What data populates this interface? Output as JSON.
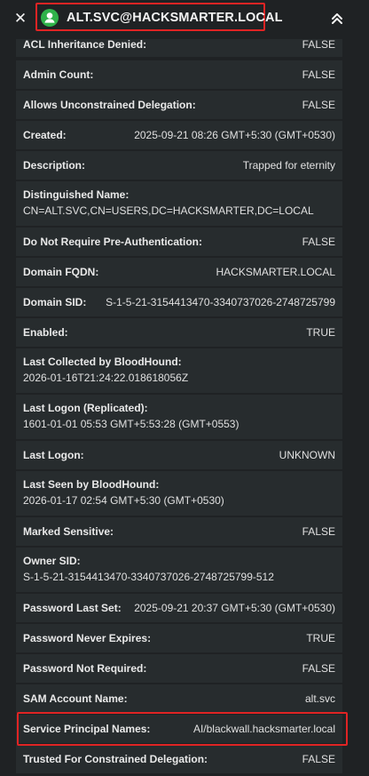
{
  "header": {
    "close_glyph": "✕",
    "title": "ALT.SVC@HACKSMARTER.LOCAL",
    "avatar_icon": "user-icon",
    "avatar_color": "#2fb24a",
    "collapse_icon": "chevrons-up-icon",
    "highlight_color": "#e02424"
  },
  "properties": [
    {
      "label": "ACL Inheritance Denied:",
      "value": "FALSE"
    },
    {
      "label": "Admin Count:",
      "value": "FALSE"
    },
    {
      "label": "Allows Unconstrained Delegation:",
      "value": "FALSE"
    },
    {
      "label": "Created:",
      "value": "2025-09-21 08:26 GMT+5:30 (GMT+0530)"
    },
    {
      "label": "Description:",
      "value": "Trapped for eternity"
    },
    {
      "label": "Distinguished Name:",
      "value": "CN=ALT.SVC,CN=USERS,DC=HACKSMARTER,DC=LOCAL"
    },
    {
      "label": "Do Not Require Pre-Authentication:",
      "value": "FALSE"
    },
    {
      "label": "Domain FQDN:",
      "value": "HACKSMARTER.LOCAL"
    },
    {
      "label": "Domain SID:",
      "value": "S-1-5-21-3154413470-3340737026-2748725799"
    },
    {
      "label": "Enabled:",
      "value": "TRUE"
    },
    {
      "label": "Last Collected by BloodHound:",
      "value": "2026-01-16T21:24:22.018618056Z"
    },
    {
      "label": "Last Logon (Replicated):",
      "value": "1601-01-01 05:53 GMT+5:53:28 (GMT+0553)"
    },
    {
      "label": "Last Logon:",
      "value": "UNKNOWN"
    },
    {
      "label": "Last Seen by BloodHound:",
      "value": "2026-01-17 02:54 GMT+5:30 (GMT+0530)"
    },
    {
      "label": "Marked Sensitive:",
      "value": "FALSE"
    },
    {
      "label": "Owner SID:",
      "value": "S-1-5-21-3154413470-3340737026-2748725799-512"
    },
    {
      "label": "Password Last Set:",
      "value": "2025-09-21 20:37 GMT+5:30 (GMT+0530)"
    },
    {
      "label": "Password Never Expires:",
      "value": "TRUE"
    },
    {
      "label": "Password Not Required:",
      "value": "FALSE"
    },
    {
      "label": "SAM Account Name:",
      "value": "alt.svc"
    },
    {
      "label": "Service Principal Names:",
      "value": "AI/blackwall.hacksmarter.local"
    },
    {
      "label": "Trusted For Constrained Delegation:",
      "value": "FALSE"
    }
  ]
}
